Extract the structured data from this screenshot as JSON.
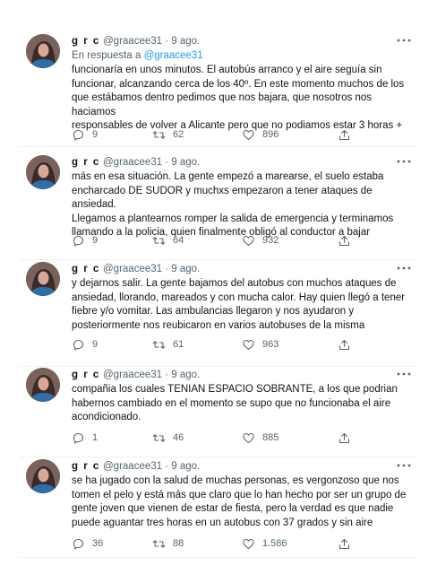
{
  "tweets": [
    {
      "name": "g r c",
      "handle": "@graacee31",
      "time": "9 ago.",
      "reply_prefix": "En respuesta a ",
      "reply_handle": "@graacee31",
      "text": "funcionaría en unos minutos. El autobús arranco y el aire seguía sin\nfuncionar, alcanzando cerca de los 40º. En este momento muchos de los\nque estábamos dentro pedimos que nos bajara, que nosotros nos haciamos\nresponsables de volver a Alicante pero que no podiamos estar 3 horas +",
      "replies": "9",
      "retweets": "62",
      "likes": "896"
    },
    {
      "name": "g r c",
      "handle": "@graacee31",
      "time": "9 ago.",
      "text": "más en esa situación. La gente empezó a marearse, el suelo estaba\nencharcado DE SUDOR y muchxs empezaron a tener ataques de ansiedad.\nLlegamos a plantearnos romper la salida de emergencia y terminamos\nllamando a la policia, quien finalmente obligó al conductor a bajar",
      "replies": "9",
      "retweets": "64",
      "likes": "932"
    },
    {
      "name": "g r c",
      "handle": "@graacee31",
      "time": "9 ago.",
      "text": "y dejarnos salir. La gente bajamos del autobus con muchos ataques de\nansiedad, llorando, mareados y con mucha calor. Hay quien llegó a tener\nfiebre y/o vomitar. Las ambulancias llegaron y nos ayudaron y\nposteriormente nos reubicaron en varios autobuses de la misma",
      "replies": "9",
      "retweets": "61",
      "likes": "963"
    },
    {
      "name": "g r c",
      "handle": "@graacee31",
      "time": "9 ago.",
      "text": "compañia los cuales TENIAN ESPACIO SOBRANTE, a los que podrian\nhabernos cambiado en el momento se supo que no funcionaba el aire\nacondicionado.",
      "replies": "1",
      "retweets": "46",
      "likes": "885"
    },
    {
      "name": "g r c",
      "handle": "@graacee31",
      "time": "9 ago.",
      "text": "se ha jugado con la salud de muchas personas, es vergonzoso que nos\ntomen el pelo y está más que claro que lo han hecho por ser un grupo de\ngente joven que vienen de estar de fiesta, pero la verdad es que nadie\npuede aguantar tres horas en un autobus con 37 grados y sin aire",
      "replies": "36",
      "retweets": "88",
      "likes": "1.586"
    }
  ],
  "separator": "·",
  "icons": {
    "reply": "reply-icon",
    "retweet": "retweet-icon",
    "like": "like-icon",
    "share": "share-icon",
    "more": "more-icon"
  },
  "colors": {
    "text": "#0f1419",
    "secondary": "#536471",
    "link": "#1d9bf0",
    "divider": "#eff3f4"
  }
}
